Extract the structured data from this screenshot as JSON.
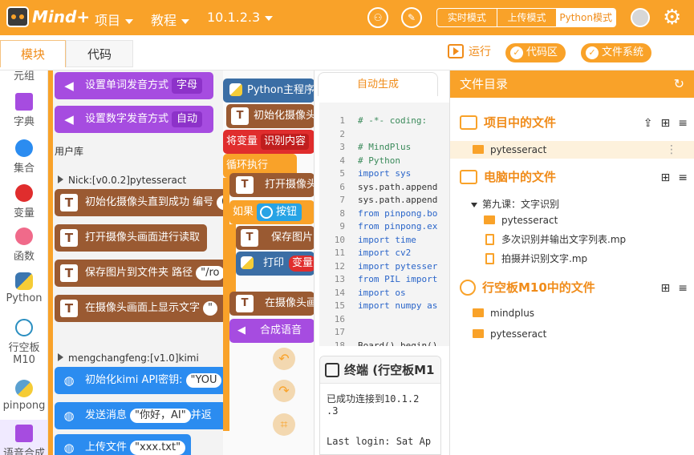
{
  "app": {
    "logo_text": "Mind+"
  },
  "topbar": {
    "menu_project": "项目",
    "menu_tutorial": "教程",
    "version": "10.1.2.3",
    "modes": [
      "实时模式",
      "上传模式",
      "Python模式"
    ]
  },
  "tabs": {
    "blocks": "模块",
    "code": "代码"
  },
  "actions": {
    "run": "运行",
    "code_area": "代码区",
    "file_system": "文件系统"
  },
  "categories": [
    {
      "label": "元组",
      "color": "#f9a229"
    },
    {
      "label": "字典",
      "color": "#a64ce0"
    },
    {
      "label": "集合",
      "color": "#2b8cf0"
    },
    {
      "label": "变量",
      "color": "#e02d2d"
    },
    {
      "label": "函数",
      "color": "#f06a8a"
    },
    {
      "label": "Python",
      "color": "#3b76b0"
    },
    {
      "label": "行空板\nM10",
      "color": "#2a8ec0"
    },
    {
      "label": "pinpong",
      "color": "#5aa0d0"
    },
    {
      "label": "语音合成",
      "color": "#a64ce0"
    }
  ],
  "palette": {
    "purple_blocks": [
      {
        "text": "设置单词发音方式",
        "dropdown": "字母"
      },
      {
        "text": "设置数字发音方式",
        "dropdown": "自动"
      }
    ],
    "user_library": "用户库",
    "lib1_title": "Nick:[v0.0.2]pytesseract",
    "lib1_blocks": [
      {
        "text": "初始化摄像头直到成功 编号",
        "slot": "0"
      },
      {
        "text": "打开摄像头画面进行读取",
        "slot": ""
      },
      {
        "text": "保存图片到文件夹 路径",
        "slot": "\"/ro"
      },
      {
        "text": "在摄像头画面上显示文字",
        "slot": "\""
      }
    ],
    "lib2_title": "mengchangfeng:[v1.0]kimi",
    "lib2_blocks": [
      {
        "text": "初始化kimi API密钥:",
        "slot": "\"YOU",
        "tail": ""
      },
      {
        "text": "发送消息",
        "slot": "\"你好，AI\"",
        "tail": "并返"
      },
      {
        "text": "上传文件",
        "slot": "\"xxx.txt\"",
        "tail": ""
      }
    ]
  },
  "workspace": {
    "main": "Python主程序",
    "init_cam": "初始化摄像头",
    "set_var": "将变量",
    "var_name": "识别内容",
    "loop": "循环执行",
    "open_cam": "打开摄像头",
    "if": "如果",
    "button": "按钮",
    "save_img": "保存图片",
    "print": "打印",
    "print_var": "变量",
    "show_cam": "在摄像头画",
    "speech": "合成语音"
  },
  "code": {
    "tab": "自动生成",
    "lines": [
      {
        "n": "1",
        "t": "# -*- coding: ",
        "k": "cm"
      },
      {
        "n": "2",
        "t": "",
        "k": ""
      },
      {
        "n": "3",
        "t": "# MindPlus",
        "k": "cm"
      },
      {
        "n": "4",
        "t": "# Python",
        "k": "cm"
      },
      {
        "n": "5",
        "t": "import sys",
        "k": "kw"
      },
      {
        "n": "6",
        "t": "sys.path.append",
        "k": ""
      },
      {
        "n": "7",
        "t": "sys.path.append",
        "k": ""
      },
      {
        "n": "8",
        "t": "from pinpong.bo",
        "k": "kw"
      },
      {
        "n": "9",
        "t": "from pinpong.ex",
        "k": "kw"
      },
      {
        "n": "10",
        "t": "import time",
        "k": "kw"
      },
      {
        "n": "11",
        "t": "import cv2",
        "k": "kw"
      },
      {
        "n": "12",
        "t": "import pytesser",
        "k": "kw"
      },
      {
        "n": "13",
        "t": "from PIL import",
        "k": "kw"
      },
      {
        "n": "14",
        "t": "import os",
        "k": "kw"
      },
      {
        "n": "15",
        "t": "import numpy as",
        "k": "kw"
      },
      {
        "n": "16",
        "t": "",
        "k": ""
      },
      {
        "n": "17",
        "t": "",
        "k": ""
      },
      {
        "n": "18",
        "t": "Board().begin()",
        "k": ""
      }
    ]
  },
  "terminal": {
    "title": "终端 (行空板M1",
    "line1": "已成功连接到10.1.2",
    "line2": ".3",
    "line3": "Last login: Sat Ap"
  },
  "files": {
    "header": "文件目录",
    "project_group": "项目中的文件",
    "project_items": [
      "pytesseract"
    ],
    "computer_group": "电脑中的文件",
    "lesson_folder": "第九课：文字识别",
    "lesson_items": [
      "pytesseract",
      "多次识别并输出文字列表.mp",
      "拍摄并识别文字.mp"
    ],
    "board_group": "行空板M10中的文件",
    "board_items": [
      "mindplus",
      "pytesseract"
    ]
  },
  "colors": {
    "accent": "#f9a229",
    "accent_dark": "#f08c1a",
    "purple": "#a64ce0",
    "brown": "#9a5a32",
    "blue": "#2b8cf0"
  }
}
